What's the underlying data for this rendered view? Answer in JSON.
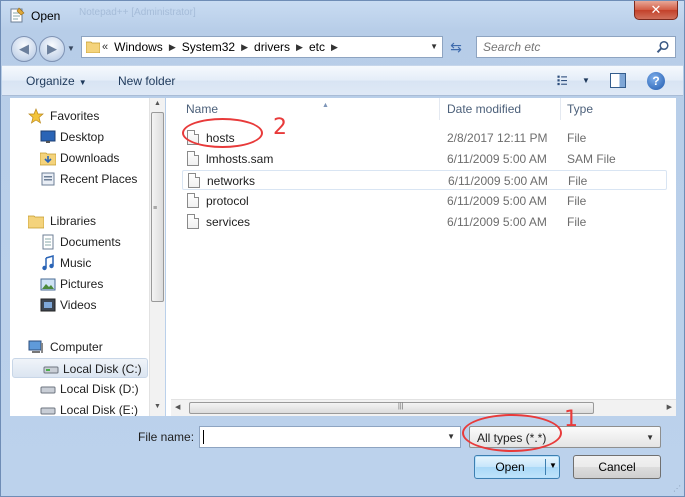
{
  "window": {
    "title": "Open",
    "title_ghost": "Notepad++ [Administrator]",
    "close_label": "✕"
  },
  "address": {
    "recent_glyph": "«",
    "crumbs": [
      "Windows",
      "System32",
      "drivers",
      "etc"
    ],
    "search_placeholder": "Search etc"
  },
  "toolbar": {
    "organize": "Organize",
    "new_folder": "New folder",
    "help": "?"
  },
  "nav": {
    "favorites": "Favorites",
    "desktop": "Desktop",
    "downloads": "Downloads",
    "recent_places": "Recent Places",
    "libraries": "Libraries",
    "documents": "Documents",
    "music": "Music",
    "pictures": "Pictures",
    "videos": "Videos",
    "computer": "Computer",
    "local_c": "Local Disk (C:)",
    "local_d": "Local Disk (D:)",
    "local_e": "Local Disk (E:)"
  },
  "columns": {
    "name": "Name",
    "date": "Date modified",
    "type": "Type"
  },
  "files": [
    {
      "name": "hosts",
      "date": "2/8/2017 12:11 PM",
      "type": "File"
    },
    {
      "name": "lmhosts.sam",
      "date": "6/11/2009 5:00 AM",
      "type": "SAM File"
    },
    {
      "name": "networks",
      "date": "6/11/2009 5:00 AM",
      "type": "File"
    },
    {
      "name": "protocol",
      "date": "6/11/2009 5:00 AM",
      "type": "File"
    },
    {
      "name": "services",
      "date": "6/11/2009 5:00 AM",
      "type": "File"
    }
  ],
  "bottom": {
    "filename_label": "File name:",
    "filename_value": "",
    "filetype": "All types (*.*)",
    "open": "Open",
    "cancel": "Cancel"
  },
  "annotations": {
    "n1": "1",
    "n2": "2",
    "color": "#e83a3a"
  },
  "colors": {
    "accent": "#3c7fb1",
    "frame": "#bcd2ec"
  }
}
